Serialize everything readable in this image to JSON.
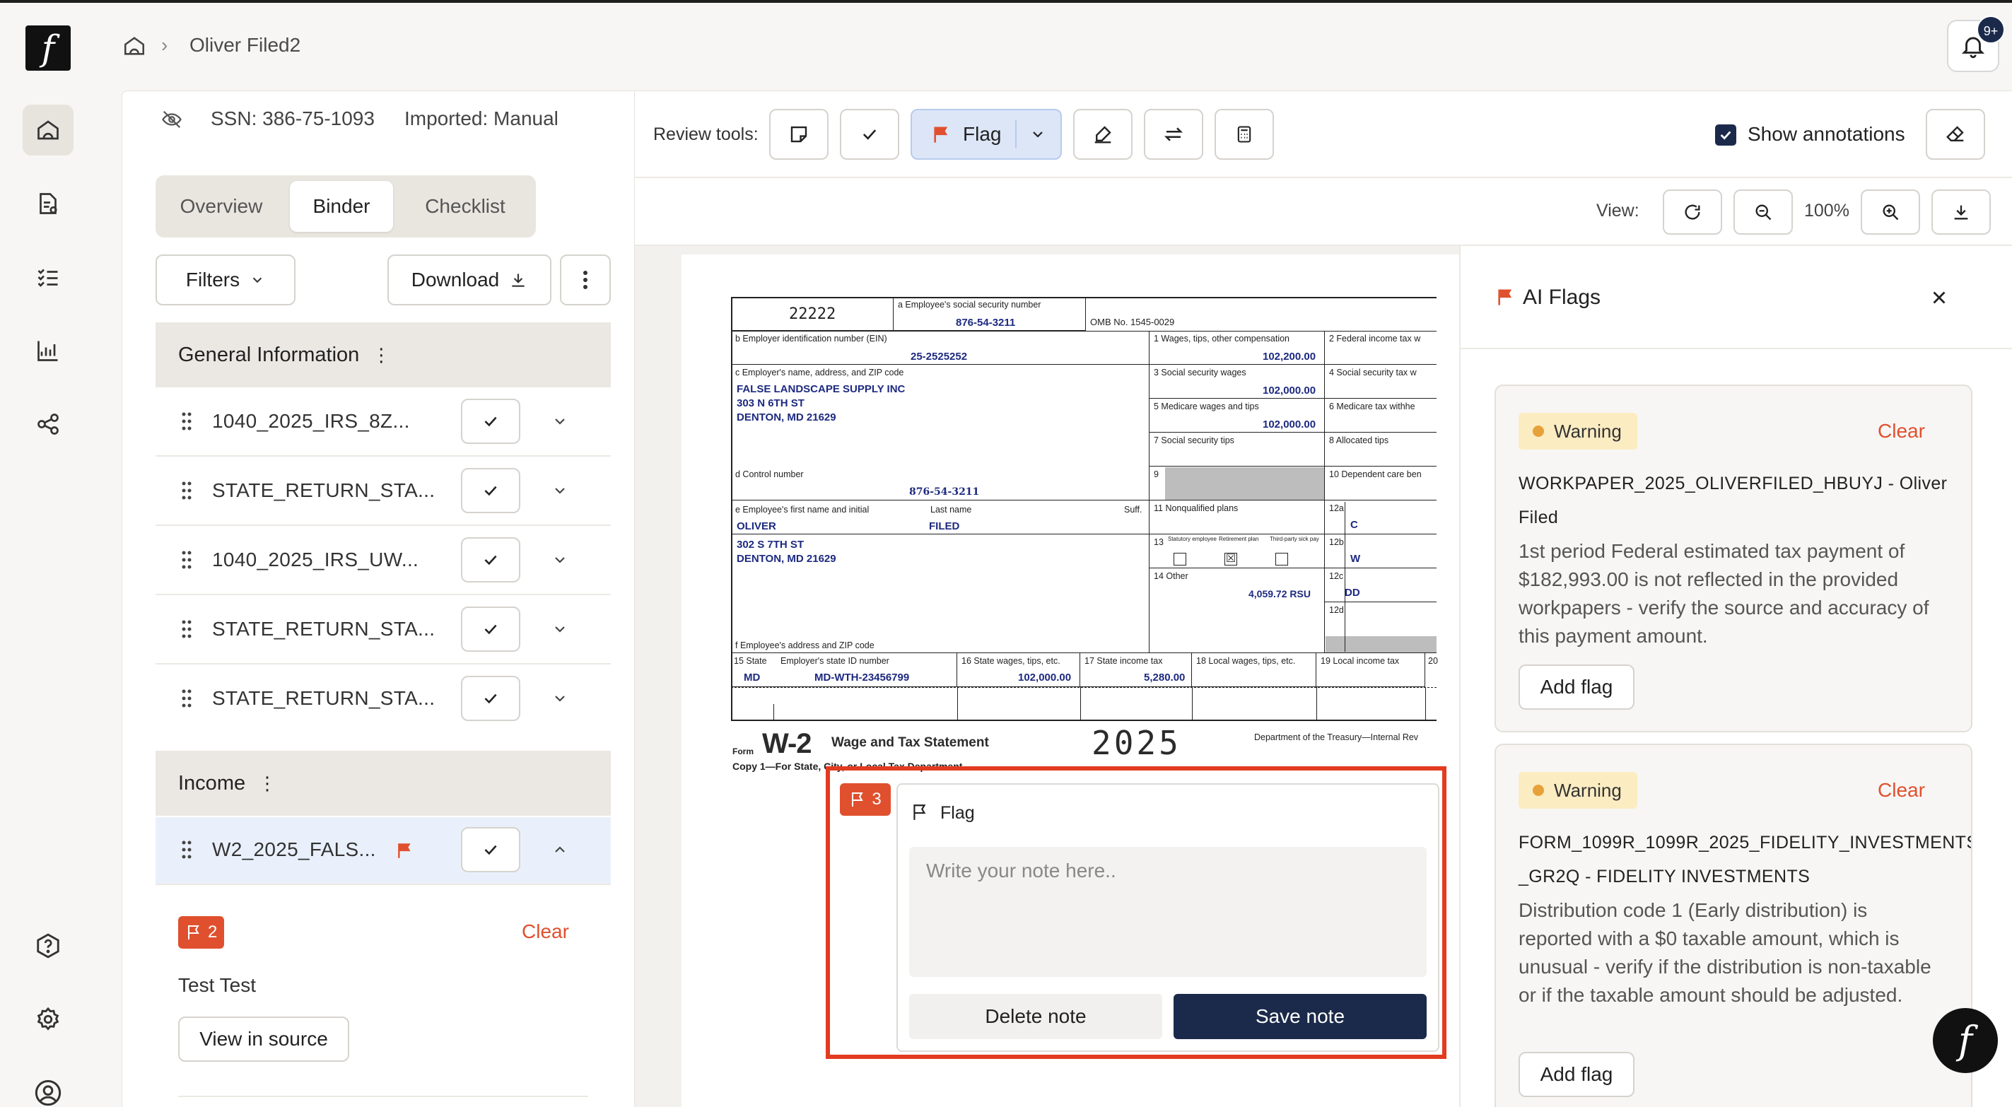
{
  "header": {
    "breadcrumb_client": "Oliver Filed2",
    "notification_count": "9+"
  },
  "client": {
    "ssn": "SSN: 386-75-1093",
    "imported": "Imported: Manual"
  },
  "tabs": [
    "Overview",
    "Binder",
    "Checklist"
  ],
  "binder": {
    "filters_label": "Filters",
    "download_label": "Download",
    "sections": [
      {
        "title": "General Information",
        "files": [
          "1040_2025_IRS_8Z...",
          "STATE_RETURN_STA...",
          "1040_2025_IRS_UW...",
          "STATE_RETURN_STA...",
          "STATE_RETURN_STA..."
        ]
      },
      {
        "title": "Income",
        "files": [
          "W2_2025_FALS..."
        ]
      }
    ],
    "flag_detail": {
      "count": "2",
      "clear_label": "Clear",
      "note": "Test Test",
      "view_source_label": "View in source"
    }
  },
  "review_tools": {
    "label": "Review tools:",
    "flag_label": "Flag",
    "show_annotations_label": "Show annotations",
    "show_annotations_checked": true
  },
  "view": {
    "label": "View:",
    "zoom": "100%"
  },
  "w2": {
    "control_code": "22222",
    "lbl_a": "a  Employee's social security number",
    "employee_ssn": "876-54-3211",
    "omb": "OMB No. 1545-0029",
    "lbl_b": "b  Employer identification number (EIN)",
    "ein": "25-2525252",
    "lbl_c": "c  Employer's name, address, and ZIP code",
    "employer_name": "FALSE LANDSCAPE SUPPLY INC",
    "employer_street": "303 N 6TH ST",
    "employer_city": "DENTON, MD 21629",
    "lbl_d": "d  Control number",
    "control_number": "876-54-3211",
    "lbl_e": "e  Employee's first name and initial",
    "lbl_last": "Last name",
    "lbl_suff": "Suff.",
    "first_name": "OLIVER",
    "last_name": "FILED",
    "employee_street": "302 S 7TH ST",
    "employee_city": "DENTON, MD 21629",
    "lbl_f": "f  Employee's address and ZIP code",
    "lbl_1": "1   Wages, tips, other compensation",
    "box1": "102,200.00",
    "lbl_2": "2   Federal income tax w",
    "lbl_3": "3   Social security wages",
    "box3": "102,000.00",
    "lbl_4": "4   Social security tax w",
    "lbl_5": "5   Medicare wages and tips",
    "box5": "102,000.00",
    "lbl_6": "6   Medicare tax withhe",
    "lbl_7": "7   Social security tips",
    "lbl_8": "8   Allocated tips",
    "lbl_9": "9",
    "lbl_10": "10   Dependent care ben",
    "lbl_11": "11   Nonqualified plans",
    "lbl_12a": "12a",
    "box12a": "C",
    "lbl_12b": "12b",
    "box12b": "W",
    "lbl_12c": "12c",
    "box12c": "DD",
    "lbl_12d": "12d",
    "lbl_13": "13",
    "lbl_13_statutory": "Statutory employee",
    "lbl_13_retirement": "Retirement plan",
    "lbl_13_thirdparty": "Third-party sick pay",
    "lbl_14": "14   Other",
    "box14": "4,059.72 RSU",
    "lbl_15": "15  State",
    "lbl_15b": "Employer's state ID number",
    "state": "MD",
    "state_id": "MD-WTH-23456799",
    "lbl_16": "16  State wages, tips, etc.",
    "box16": "102,000.00",
    "lbl_17": "17  State income tax",
    "box17": "5,280.00",
    "lbl_18": "18  Local wages, tips, etc.",
    "lbl_19": "19  Local income tax",
    "lbl_20": "20",
    "form_label": "Form",
    "form_name": "W-2",
    "form_title": "Wage and Tax Statement",
    "year": "2025",
    "dept": "Department of the Treasury—Internal Rev",
    "copy": "Copy 1—For State, City, or Local Tax Department"
  },
  "note_popup": {
    "flag_count": "3",
    "title": "Flag",
    "placeholder": "Write your note here..",
    "delete_label": "Delete note",
    "save_label": "Save note"
  },
  "ai_flags": {
    "title": "AI Flags",
    "cards": [
      {
        "severity": "Warning",
        "clear_label": "Clear",
        "title": "WORKPAPER_2025_OLIVERFILED_HBUYJ - Oliver Filed",
        "body": "1st period Federal estimated tax payment of $182,993.00 is not reflected in the provided workpapers - verify the source and accuracy of this payment amount.",
        "add_label": "Add flag"
      },
      {
        "severity": "Warning",
        "clear_label": "Clear",
        "title": "FORM_1099R_1099R_2025_FIDELITY_INVESTMENTS_GR2Q - FIDELITY INVESTMENTS",
        "body": "Distribution code 1 (Early distribution) is reported with a $0 taxable amount, which is unusual - verify if the distribution is non-taxable or if the taxable amount should be adjusted.",
        "add_label": "Add flag"
      }
    ]
  },
  "colors": {
    "accent": "#E0502E",
    "navy": "#1B2A4A",
    "highlight": "#E23B1F",
    "warning_bg": "#FBECC2"
  }
}
